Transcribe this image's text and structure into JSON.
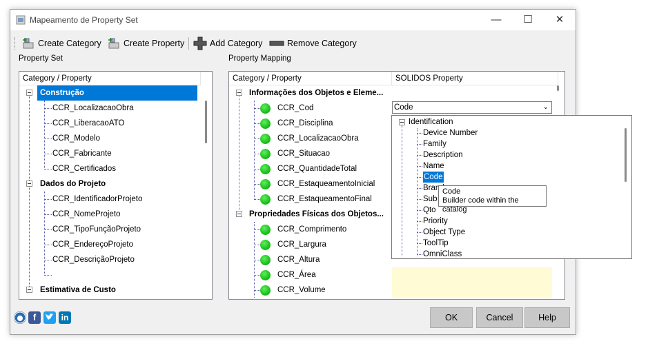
{
  "window": {
    "title": "Mapeamento de Property Set",
    "minimize": "—",
    "maximize": "☐",
    "close": "✕"
  },
  "toolbar": {
    "create_category": "Create Category",
    "create_property": "Create Property",
    "add_category": "Add Category",
    "remove_category": "Remove Category"
  },
  "property_set": {
    "group_label": "Property Set",
    "header": "Category / Property",
    "categories": [
      {
        "label": "Construção",
        "children": [
          "CCR_LocalizacaoObra",
          "CCR_LiberacaoATO",
          "CCR_Modelo",
          "CCR_Fabricante",
          "CCR_Certificados"
        ]
      },
      {
        "label": "Dados do Projeto",
        "children": [
          "CCR_IdentificadorProjeto",
          "CCR_NomeProjeto",
          "CCR_TipoFunçãoProjeto",
          "CCR_EndereçoProjeto",
          "CCR_DescriçãoProjeto"
        ]
      },
      {
        "label": "Estimativa de Custo",
        "children": []
      }
    ]
  },
  "property_mapping": {
    "group_label": "Property Mapping",
    "col1": "Category / Property",
    "col2": "SOLIDOS Property",
    "group1": "Informações dos Objetos e Eleme...",
    "group1_items": [
      "CCR_Cod",
      "CCR_Disciplina",
      "CCR_LocalizacaoObra",
      "CCR_Situacao",
      "CCR_QuantidadeTotal",
      "CCR_EstaqueamentoInicial",
      "CCR_EstaqueamentoFinal"
    ],
    "group2": "Propriedades Físicas dos Objetos...",
    "group2_items": [
      "CCR_Comprimento",
      "CCR_Largura",
      "CCR_Altura",
      "CCR_Área",
      "CCR_Volume"
    ],
    "combo_value": "Code"
  },
  "dropdown": {
    "root": "Identification",
    "items": [
      "Device Number",
      "Family",
      "Description",
      "Name",
      "Code",
      "Brand",
      "Sub",
      "Qto",
      "Priority",
      "Object Type",
      "ToolTip",
      "OmniClass"
    ],
    "selected": "Code"
  },
  "tooltip": {
    "title": "Code",
    "text": "Builder code within the catalog"
  },
  "buttons": {
    "ok": "OK",
    "cancel": "Cancel",
    "help": "Help"
  },
  "social": {
    "facebook": "f",
    "linkedin": "in"
  }
}
